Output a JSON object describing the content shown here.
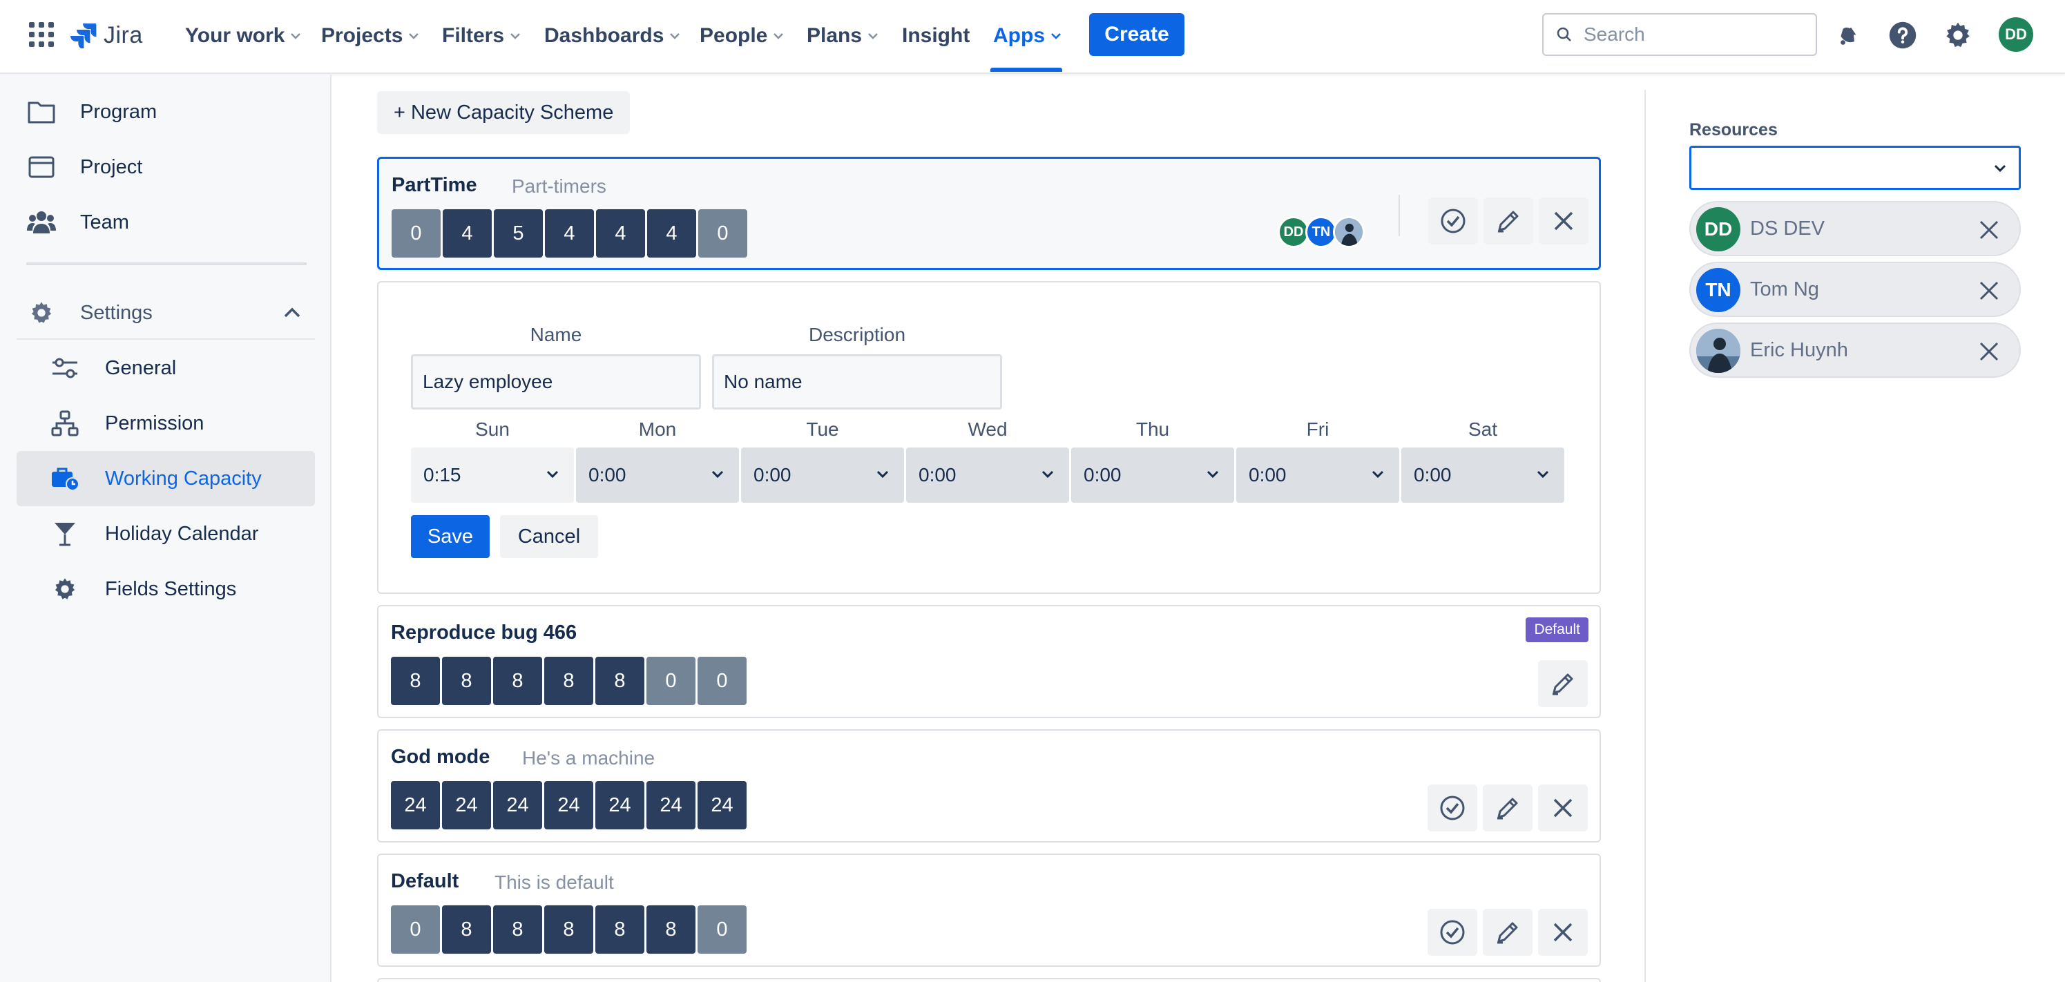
{
  "header": {
    "logo_text": "Jira",
    "nav": [
      {
        "label": "Your work"
      },
      {
        "label": "Projects"
      },
      {
        "label": "Filters"
      },
      {
        "label": "Dashboards"
      },
      {
        "label": "People"
      },
      {
        "label": "Plans"
      },
      {
        "label": "Insight"
      },
      {
        "label": "Apps"
      }
    ],
    "create_label": "Create",
    "search_placeholder": "Search",
    "user_initials": "DD",
    "accent_color": "#0c66e4"
  },
  "sidebar": {
    "items": [
      {
        "label": "Program",
        "icon": "folder-icon"
      },
      {
        "label": "Project",
        "icon": "board-icon"
      },
      {
        "label": "Team",
        "icon": "people-icon"
      }
    ],
    "settings_label": "Settings",
    "sub_items": [
      {
        "label": "General",
        "icon": "sliders-icon"
      },
      {
        "label": "Permission",
        "icon": "hierarchy-icon"
      },
      {
        "label": "Working Capacity",
        "icon": "briefcase-clock-icon",
        "selected": true
      },
      {
        "label": "Holiday Calendar",
        "icon": "cocktail-icon"
      },
      {
        "label": "Fields Settings",
        "icon": "gear-icon"
      }
    ]
  },
  "main": {
    "new_scheme_label": "+ New Capacity Scheme",
    "schemes": [
      {
        "name": "PartTime",
        "description": "Part-timers",
        "hours": [
          "0",
          "4",
          "5",
          "4",
          "4",
          "4",
          "0"
        ],
        "members": [
          "DD",
          "TN",
          ""
        ]
      },
      {
        "name": "Reproduce bug 466",
        "description": "",
        "badge": "Default",
        "hours": [
          "8",
          "8",
          "8",
          "8",
          "8",
          "0",
          "0"
        ]
      },
      {
        "name": "God mode",
        "description": "He's a machine",
        "hours": [
          "24",
          "24",
          "24",
          "24",
          "24",
          "24",
          "24"
        ]
      },
      {
        "name": "Default",
        "description": "This is default",
        "hours": [
          "0",
          "8",
          "8",
          "8",
          "8",
          "8",
          "0"
        ]
      }
    ],
    "form": {
      "name_label": "Name",
      "description_label": "Description",
      "name_value": "Lazy employee",
      "description_value": "No name",
      "days": [
        {
          "label": "Sun",
          "value": "0:15"
        },
        {
          "label": "Mon",
          "value": "0:00"
        },
        {
          "label": "Tue",
          "value": "0:00"
        },
        {
          "label": "Wed",
          "value": "0:00"
        },
        {
          "label": "Thu",
          "value": "0:00"
        },
        {
          "label": "Fri",
          "value": "0:00"
        },
        {
          "label": "Sat",
          "value": "0:00"
        }
      ],
      "save_label": "Save",
      "cancel_label": "Cancel"
    }
  },
  "resources": {
    "label": "Resources",
    "selected_value": "",
    "people": [
      {
        "initials": "DD",
        "name": "DS DEV",
        "color": "#1f845a"
      },
      {
        "initials": "TN",
        "name": "Tom Ng",
        "color": "#0c66e4"
      },
      {
        "initials": "",
        "name": "Eric Huynh",
        "color": "#6a8caf"
      }
    ]
  }
}
